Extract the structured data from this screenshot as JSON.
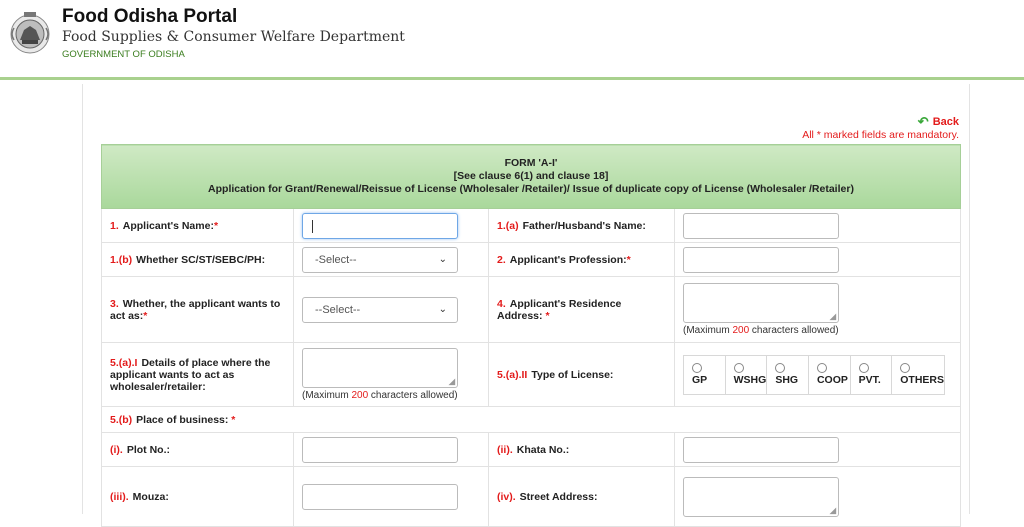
{
  "header": {
    "title": "Food Odisha Portal",
    "department": "Food Supplies & Consumer Welfare Department",
    "government": "GOVERNMENT OF ODISHA"
  },
  "nav": {
    "back_label": "Back"
  },
  "notice": "All * marked fields are mandatory.",
  "form_head": {
    "line1": "FORM 'A-I'",
    "line2": "[See clause 6(1) and clause 18]",
    "line3": "Application for Grant/Renewal/Reissue of License (Wholesaler /Retailer)/ Issue of duplicate copy of License (Wholesaler /Retailer)"
  },
  "fields": {
    "f1": {
      "num": "1.",
      "label": "Applicant's Name:"
    },
    "f1a": {
      "num": "1.(a)",
      "label": "Father/Husband's Name:"
    },
    "f1b": {
      "num": "1.(b)",
      "label": "Whether SC/ST/SEBC/PH:",
      "selected": "-Select--"
    },
    "f2": {
      "num": "2.",
      "label": "Applicant's Profession:"
    },
    "f3": {
      "num": "3.",
      "label": "Whether, the applicant wants to act as:",
      "selected": "--Select--"
    },
    "f4": {
      "num": "4.",
      "label": "Applicant's Residence Address:"
    },
    "f5a1": {
      "num": "5.(a).I",
      "label": "Details of place where the applicant wants to act as wholesaler/retailer:"
    },
    "f5a2": {
      "num": "5.(a).II",
      "label": "Type of License:"
    },
    "f5b": {
      "num": "5.(b)",
      "label": "Place of business:"
    },
    "fi": {
      "num": "(i).",
      "label": "Plot No.:"
    },
    "fii": {
      "num": "(ii).",
      "label": "Khata No.:"
    },
    "fiii": {
      "num": "(iii).",
      "label": "Mouza:"
    },
    "fiv": {
      "num": "(iv).",
      "label": "Street Address:"
    }
  },
  "hint": {
    "prefix": "(Maximum",
    "max": "200",
    "suffix": "characters allowed)"
  },
  "license_types": [
    "GP",
    "WSHG",
    "SHG",
    "COOP",
    "PVT.",
    "OTHERS"
  ],
  "required_marker": "*"
}
